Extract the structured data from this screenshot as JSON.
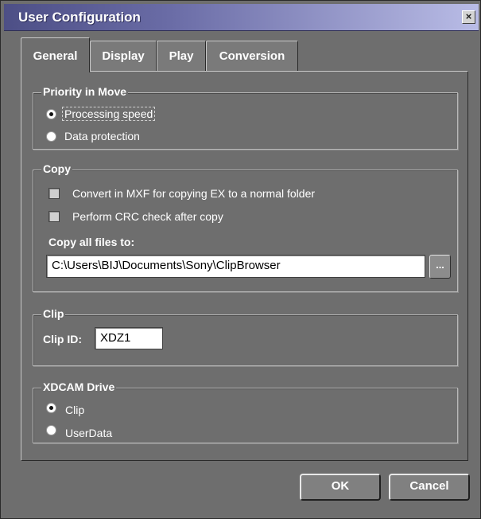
{
  "window": {
    "title": "User Configuration",
    "close_glyph": "×"
  },
  "tabs": [
    {
      "label": "General",
      "active": true
    },
    {
      "label": "Display",
      "active": false
    },
    {
      "label": "Play",
      "active": false
    },
    {
      "label": "Conversion",
      "active": false
    }
  ],
  "priority": {
    "legend": "Priority in Move",
    "options": [
      {
        "label": "Processing speed",
        "checked": true
      },
      {
        "label": "Data protection",
        "checked": false
      }
    ]
  },
  "copy": {
    "legend": "Copy",
    "checkboxes": [
      {
        "label": "Convert in MXF for copying EX to a normal folder",
        "checked": false
      },
      {
        "label": "Perform CRC check after copy",
        "checked": false
      }
    ],
    "dest_label": "Copy all files to:",
    "dest_value": "C:\\Users\\BIJ\\Documents\\Sony\\ClipBrowser",
    "browse_label": "..."
  },
  "clip": {
    "legend": "Clip",
    "id_label": "Clip ID:",
    "id_value": "XDZ1"
  },
  "xdcam": {
    "legend": "XDCAM Drive",
    "options": [
      {
        "label": "Clip",
        "checked": true
      },
      {
        "label": "UserData",
        "checked": false
      }
    ]
  },
  "buttons": {
    "ok": "OK",
    "cancel": "Cancel"
  }
}
